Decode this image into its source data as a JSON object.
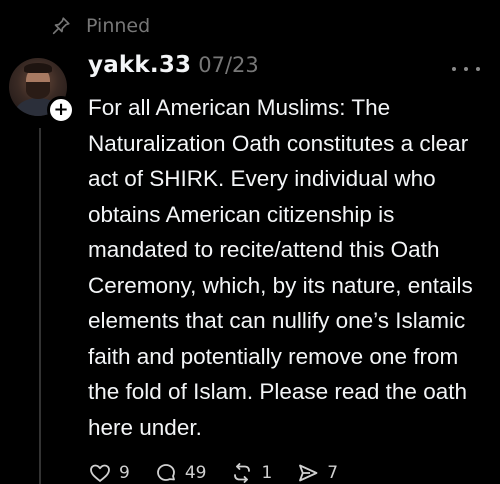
{
  "pinned": {
    "label": "Pinned",
    "icon": "pin-icon"
  },
  "post": {
    "username": "yakk.33",
    "date": "07/23",
    "text": "For all American Muslims: The Naturalization Oath constitutes a clear act of SHIRK. Every individual who obtains American citizenship is mandated to recite/attend this Oath Ceremony, which, by its nature, entails elements that can nullify one’s Islamic faith and potentially remove one from the fold of Islam. Please read the oath here under.",
    "avatar_icon": "avatar",
    "follow_icon": "plus-icon"
  },
  "actions": {
    "likes": "9",
    "replies": "49",
    "reposts": "1",
    "shares": "7"
  },
  "colors": {
    "background": "#000000",
    "text": "#f3f5f7",
    "muted": "#777777",
    "thread_line": "#333333"
  }
}
